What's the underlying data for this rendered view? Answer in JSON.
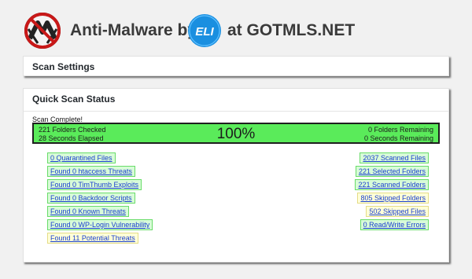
{
  "header": {
    "title_prefix": "Anti-Malware by",
    "title_suffix": "at GOTMLS.NET",
    "eli_logo_text": "ELI"
  },
  "colors": {
    "page_bg": "#f1f1f1",
    "progress_green": "#5aeb5a",
    "badge_green_bg": "#d8fbd8",
    "badge_yellow_bg": "#ffffd8",
    "link_blue": "#1a3fd0",
    "eli_blue": "#1a8fe0"
  },
  "scan_settings": {
    "title": "Scan Settings"
  },
  "quick_scan": {
    "title": "Quick Scan Status",
    "scan_complete": "Scan Complete!",
    "progress": {
      "folders_checked": "221 Folders Checked",
      "seconds_elapsed": "28 Seconds Elapsed",
      "percent": "100%",
      "folders_remaining": "0 Folders Remaining",
      "seconds_remaining": "0 Seconds Remaining"
    },
    "left_results": [
      {
        "label": "0 Quarantined Files",
        "color": "green"
      },
      {
        "label": "Found 0 htaccess Threats",
        "color": "green"
      },
      {
        "label": "Found 0 TimThumb Exploits",
        "color": "green"
      },
      {
        "label": "Found 0 Backdoor Scripts",
        "color": "green"
      },
      {
        "label": "Found 0 Known Threats",
        "color": "green"
      },
      {
        "label": "Found 0 WP-Login Vulnerability",
        "color": "green"
      },
      {
        "label": "Found 11 Potential Threats",
        "color": "yellow"
      }
    ],
    "right_results": [
      {
        "label": "2037 Scanned Files",
        "color": "green"
      },
      {
        "label": "221 Selected Folders",
        "color": "green"
      },
      {
        "label": "221 Scanned Folders",
        "color": "green"
      },
      {
        "label": "805 Skipped Folders",
        "color": "yellow"
      },
      {
        "label": "502 Skipped Files",
        "color": "yellow"
      },
      {
        "label": "0 Read/Write Errors",
        "color": "green"
      }
    ]
  }
}
